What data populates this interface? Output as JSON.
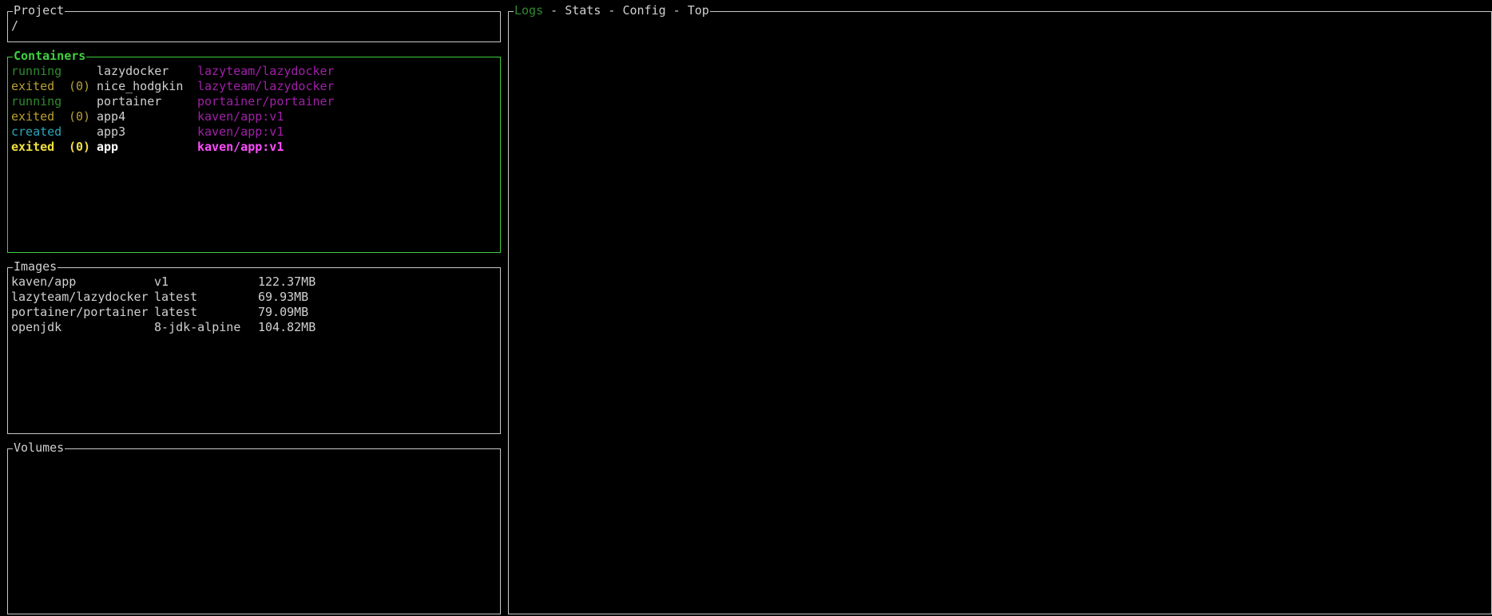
{
  "colors": {
    "running": "#2e8b2e",
    "exited": "#b8a030",
    "created": "#2aa7b8",
    "image_ref": "#a020a8",
    "selected_status": "#f0e040",
    "selected_image": "#ff4cff",
    "active_tab": "#2e8b2e",
    "active_border": "#3fcf3f"
  },
  "project": {
    "title": "Project",
    "value": "/"
  },
  "containers": {
    "title": "Containers",
    "items": [
      {
        "status": "running",
        "code": "",
        "name": "lazydocker",
        "image": "lazyteam/lazydocker",
        "selected": false
      },
      {
        "status": "exited",
        "code": "(0)",
        "name": "nice_hodgkin",
        "image": "lazyteam/lazydocker",
        "selected": false
      },
      {
        "status": "running",
        "code": "",
        "name": "portainer",
        "image": "portainer/portainer",
        "selected": false
      },
      {
        "status": "exited",
        "code": "(0)",
        "name": "app4",
        "image": "kaven/app:v1",
        "selected": false
      },
      {
        "status": "created",
        "code": "",
        "name": "app3",
        "image": "kaven/app:v1",
        "selected": false
      },
      {
        "status": "exited",
        "code": "(0)",
        "name": "app",
        "image": "kaven/app:v1",
        "selected": true
      }
    ]
  },
  "images": {
    "title": "Images",
    "items": [
      {
        "name": "kaven/app",
        "tag": "v1",
        "size": "122.37MB"
      },
      {
        "name": "lazyteam/lazydocker",
        "tag": "latest",
        "size": "69.93MB"
      },
      {
        "name": "portainer/portainer",
        "tag": "latest",
        "size": "79.09MB"
      },
      {
        "name": "openjdk",
        "tag": "8-jdk-alpine",
        "size": "104.82MB"
      }
    ]
  },
  "volumes": {
    "title": "Volumes"
  },
  "main": {
    "tabs": [
      {
        "label": "Logs",
        "active": true
      },
      {
        "label": "Stats",
        "active": false
      },
      {
        "label": "Config",
        "active": false
      },
      {
        "label": "Top",
        "active": false
      }
    ],
    "separator": " - "
  }
}
